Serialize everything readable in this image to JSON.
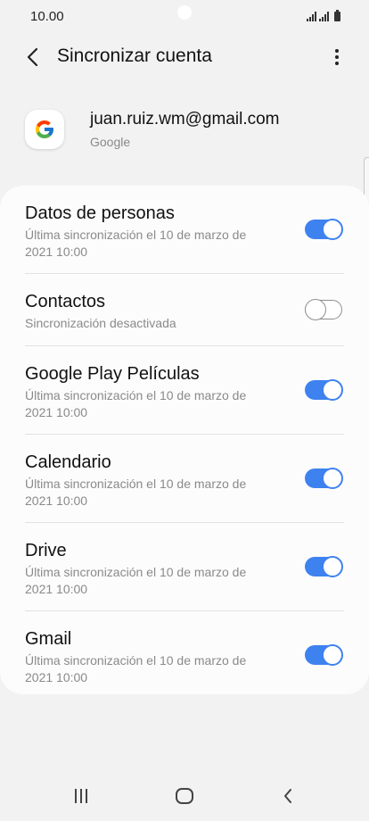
{
  "status_bar": {
    "time": "10.00"
  },
  "app_bar": {
    "title": "Sincronizar cuenta",
    "back_icon": "chevron-left-icon",
    "more_icon": "more-vertical-icon"
  },
  "account": {
    "email": "juan.ruiz.wm@gmail.com",
    "provider": "Google",
    "logo_icon": "google-logo-icon"
  },
  "sync_items": [
    {
      "title": "Datos de personas",
      "subtitle": "Última sincronización el 10 de marzo de 2021 10:00",
      "enabled": true
    },
    {
      "title": "Contactos",
      "subtitle": "Sincronización desactivada",
      "enabled": false
    },
    {
      "title": "Google Play Películas",
      "subtitle": "Última sincronización el 10 de marzo de 2021 10:00",
      "enabled": true
    },
    {
      "title": "Calendario",
      "subtitle": "Última sincronización el 10 de marzo de 2021 10:00",
      "enabled": true
    },
    {
      "title": "Drive",
      "subtitle": "Última sincronización el 10 de marzo de 2021 10:00",
      "enabled": true
    },
    {
      "title": "Gmail",
      "subtitle": "Última sincronización el 10 de marzo de 2021 10:00",
      "enabled": true
    }
  ],
  "nav_bar": {
    "recents_icon": "recents-icon",
    "home_icon": "home-icon",
    "back_icon": "back-icon"
  },
  "colors": {
    "accent": "#3e82f0",
    "background": "#f2f2f2",
    "card": "#fcfcfc"
  }
}
